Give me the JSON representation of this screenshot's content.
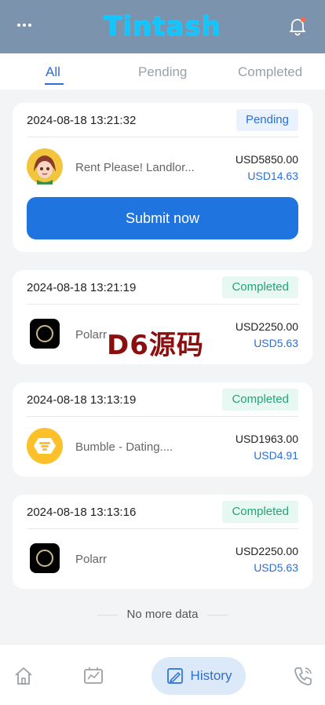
{
  "header": {
    "brand": "Tintash",
    "menu_icon": "more-dots-icon",
    "bell_icon": "bell-icon"
  },
  "tabs": [
    {
      "label": "All",
      "active": true
    },
    {
      "label": "Pending"
    },
    {
      "label": "Completed"
    }
  ],
  "orders": [
    {
      "time": "2024-08-18 13:21:32",
      "status": "Pending",
      "app": "Rent Please! Landlor...",
      "amount": "USD5850.00",
      "commission": "USD14.63",
      "icon": "rent-please-avatar-icon",
      "action": "Submit now"
    },
    {
      "time": "2024-08-18 13:21:19",
      "status": "Completed",
      "app": "Polarr",
      "amount": "USD2250.00",
      "commission": "USD5.63",
      "icon": "polarr-icon"
    },
    {
      "time": "2024-08-18 13:13:19",
      "status": "Completed",
      "app": "Bumble - Dating....",
      "amount": "USD1963.00",
      "commission": "USD4.91",
      "icon": "bumble-icon"
    },
    {
      "time": "2024-08-18 13:13:16",
      "status": "Completed",
      "app": "Polarr",
      "amount": "USD2250.00",
      "commission": "USD5.63",
      "icon": "polarr-icon"
    }
  ],
  "footer_text": "No more data",
  "watermark": "D6源码",
  "bottom_nav": {
    "home_icon": "home-icon",
    "tasks_icon": "tasks-icon",
    "history_label": "History",
    "history_icon": "history-icon",
    "service_icon": "phone-icon"
  },
  "colors": {
    "header_bg": "#7c93ad",
    "brand": "#14c4ff",
    "accent": "#1f74e0",
    "completed": "#25a27a"
  }
}
